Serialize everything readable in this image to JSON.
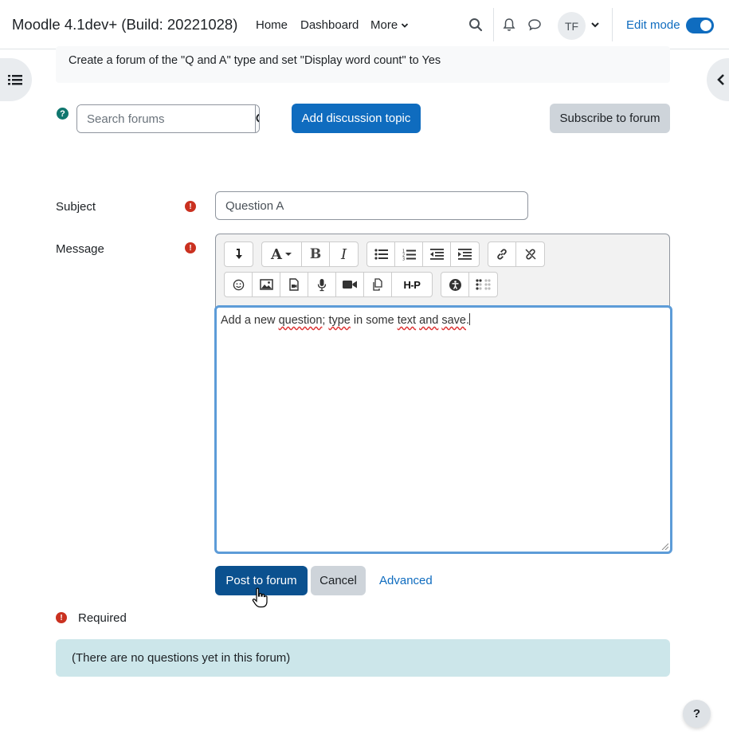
{
  "navbar": {
    "brand": "Moodle 4.1dev+ (Build: 20221028)",
    "links": [
      "Home",
      "Dashboard",
      "More"
    ],
    "avatar_initials": "TF",
    "edit_mode_label": "Edit mode",
    "edit_mode_on": true
  },
  "intro": {
    "text": "Create a forum of the \"Q and A\" type and set \"Display word count\" to Yes"
  },
  "toolbar_row": {
    "search_placeholder": "Search forums",
    "add_discussion_label": "Add discussion topic",
    "subscribe_label": "Subscribe to forum"
  },
  "form": {
    "subject_label": "Subject",
    "subject_value": "Question A",
    "message_label": "Message",
    "message_words": [
      "Add a new ",
      "question",
      "; ",
      "type",
      " in some ",
      "text",
      " ",
      "and",
      " ",
      "save",
      "."
    ],
    "post_label": "Post to forum",
    "cancel_label": "Cancel",
    "advanced_label": "Advanced",
    "required_label": "Required"
  },
  "info": {
    "text": "(There are no questions yet in this forum)"
  },
  "help_fab": "?",
  "colors": {
    "primary": "#0f6cbf",
    "required": "#ca3120",
    "info_bg": "#cce6ea"
  }
}
